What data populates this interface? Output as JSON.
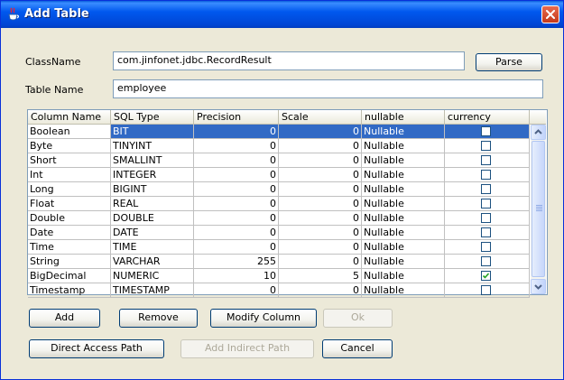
{
  "window": {
    "title": "Add Table"
  },
  "form": {
    "class_name_label": "ClassName",
    "class_name_value": "com.jinfonet.jdbc.RecordResult",
    "parse_label": "Parse",
    "table_name_label": "Table Name",
    "table_name_value": "employee"
  },
  "table": {
    "columns": [
      "Column Name",
      "SQL Type",
      "Precision",
      "Scale",
      "nullable",
      "currency"
    ],
    "rows": [
      {
        "name": "Boolean",
        "sql": "BIT",
        "precision": "0",
        "scale": "0",
        "nullable": "Nullable",
        "currency": false
      },
      {
        "name": "Byte",
        "sql": "TINYINT",
        "precision": "0",
        "scale": "0",
        "nullable": "Nullable",
        "currency": false
      },
      {
        "name": "Short",
        "sql": "SMALLINT",
        "precision": "0",
        "scale": "0",
        "nullable": "Nullable",
        "currency": false
      },
      {
        "name": "Int",
        "sql": "INTEGER",
        "precision": "0",
        "scale": "0",
        "nullable": "Nullable",
        "currency": false
      },
      {
        "name": "Long",
        "sql": "BIGINT",
        "precision": "0",
        "scale": "0",
        "nullable": "Nullable",
        "currency": false
      },
      {
        "name": "Float",
        "sql": "REAL",
        "precision": "0",
        "scale": "0",
        "nullable": "Nullable",
        "currency": false
      },
      {
        "name": "Double",
        "sql": "DOUBLE",
        "precision": "0",
        "scale": "0",
        "nullable": "Nullable",
        "currency": false
      },
      {
        "name": "Date",
        "sql": "DATE",
        "precision": "0",
        "scale": "0",
        "nullable": "Nullable",
        "currency": false
      },
      {
        "name": "Time",
        "sql": "TIME",
        "precision": "0",
        "scale": "0",
        "nullable": "Nullable",
        "currency": false
      },
      {
        "name": "String",
        "sql": "VARCHAR",
        "precision": "255",
        "scale": "0",
        "nullable": "Nullable",
        "currency": false
      },
      {
        "name": "BigDecimal",
        "sql": "NUMERIC",
        "precision": "10",
        "scale": "5",
        "nullable": "Nullable",
        "currency": true
      },
      {
        "name": "Timestamp",
        "sql": "TIMESTAMP",
        "precision": "0",
        "scale": "0",
        "nullable": "Nullable",
        "currency": false
      }
    ],
    "selected_row": 0
  },
  "buttons": {
    "add": "Add",
    "remove": "Remove",
    "modify_column": "Modify Column",
    "ok": "Ok",
    "direct_access_path": "Direct Access Path",
    "add_indirect_path": "Add Indirect Path",
    "cancel": "Cancel"
  },
  "icons": {
    "app": "java-cup-icon",
    "close": "close-icon",
    "check": "checkmark-icon"
  },
  "colors": {
    "title_bar": "#0058ee",
    "selection": "#316ac5",
    "close_button": "#d4492a",
    "check": "#21a121"
  }
}
